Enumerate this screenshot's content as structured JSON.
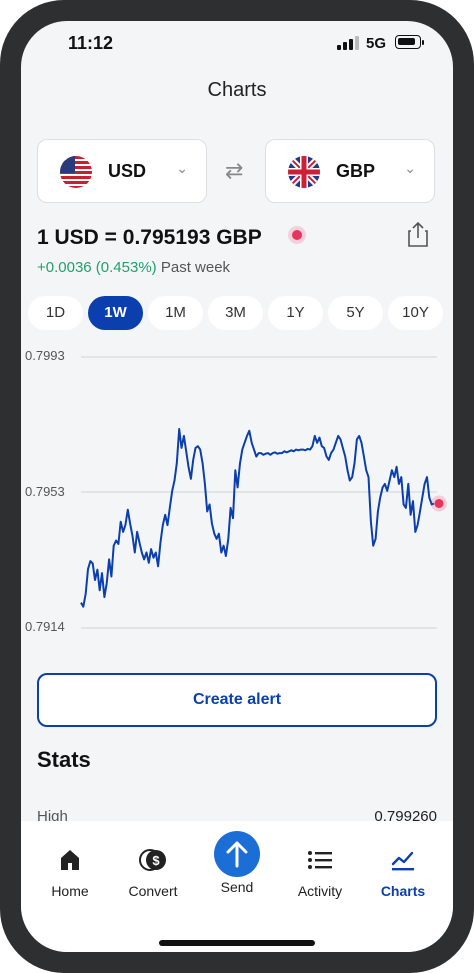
{
  "status": {
    "time": "11:12",
    "network": "5G"
  },
  "header": {
    "title": "Charts"
  },
  "pair": {
    "from": {
      "code": "USD",
      "flag": "us-flag-icon"
    },
    "to": {
      "code": "GBP",
      "flag": "uk-flag-icon"
    }
  },
  "rate": {
    "text": "1 USD = 0.795193 GBP",
    "change": "+0.0036 (0.453%)",
    "period_label": "Past week"
  },
  "ranges": [
    "1D",
    "1W",
    "1M",
    "3M",
    "1Y",
    "5Y",
    "10Y"
  ],
  "selected_range": "1W",
  "chart_data": {
    "type": "line",
    "y_ticks": [
      "0.7993",
      "0.7953",
      "0.7914"
    ],
    "ylim": [
      0.7914,
      0.7993
    ],
    "grid": true,
    "color": "#0b3fae",
    "series": [
      {
        "values": [
          0.79214,
          0.79202,
          0.7924,
          0.79312,
          0.79335,
          0.79328,
          0.7928,
          0.7931,
          0.7925,
          0.793,
          0.7923,
          0.7927,
          0.7934,
          0.7929,
          0.7938,
          0.79395,
          0.79385,
          0.7945,
          0.7942,
          0.7944,
          0.79485,
          0.79445,
          0.7941,
          0.7936,
          0.7942,
          0.7939,
          0.7936,
          0.7934,
          0.7936,
          0.7933,
          0.7937,
          0.79345,
          0.7936,
          0.7932,
          0.7939,
          0.7944,
          0.7947,
          0.7944,
          0.7949,
          0.7954,
          0.7957,
          0.7962,
          0.7972,
          0.79665,
          0.797,
          0.79655,
          0.7961,
          0.79575,
          0.7963,
          0.79665,
          0.7967,
          0.7966,
          0.7962,
          0.7956,
          0.7948,
          0.795,
          0.79445,
          0.79415,
          0.794,
          0.79415,
          0.7936,
          0.7938,
          0.7935,
          0.794,
          0.7949,
          0.7946,
          0.796,
          0.7955,
          0.7962,
          0.7966,
          0.7968,
          0.797,
          0.79715,
          0.7968,
          0.7966,
          0.7964,
          0.7965,
          0.7965,
          0.79645,
          0.79648,
          0.7965,
          0.79645,
          0.7965,
          0.79652,
          0.79648,
          0.7965,
          0.7965,
          0.79655,
          0.79652,
          0.79655,
          0.79658,
          0.79655,
          0.7966,
          0.79658,
          0.7966,
          0.7966,
          0.79658,
          0.79662,
          0.7966,
          0.7967,
          0.797,
          0.7968,
          0.79695,
          0.7967,
          0.79665,
          0.7964,
          0.7963,
          0.7965,
          0.7966,
          0.7968,
          0.797,
          0.7969,
          0.79665,
          0.7964,
          0.796,
          0.7957,
          0.7958,
          0.7962,
          0.7969,
          0.797,
          0.7968,
          0.7964,
          0.796,
          0.7958,
          0.7945,
          0.7938,
          0.794,
          0.7948,
          0.7952,
          0.7955,
          0.7956,
          0.7954,
          0.7957,
          0.796,
          0.7958,
          0.7961,
          0.7956,
          0.7958,
          0.795,
          0.7949,
          0.7956,
          0.7947,
          0.7951,
          0.7942,
          0.7944,
          0.7948,
          0.7952,
          0.7956,
          0.7958,
          0.7952,
          0.795,
          0.79503
        ]
      }
    ],
    "end_marker": 0.79503
  },
  "actions": {
    "create_alert": "Create alert"
  },
  "stats": {
    "title": "Stats",
    "high_label": "High",
    "high_value": "0.799260"
  },
  "tabs": [
    {
      "label": "Home",
      "icon": "home-icon"
    },
    {
      "label": "Convert",
      "icon": "currency-icon"
    },
    {
      "label": "Send",
      "icon": "send-arrow-icon"
    },
    {
      "label": "Activity",
      "icon": "list-icon"
    },
    {
      "label": "Charts",
      "icon": "chart-icon"
    }
  ],
  "active_tab": "Charts"
}
